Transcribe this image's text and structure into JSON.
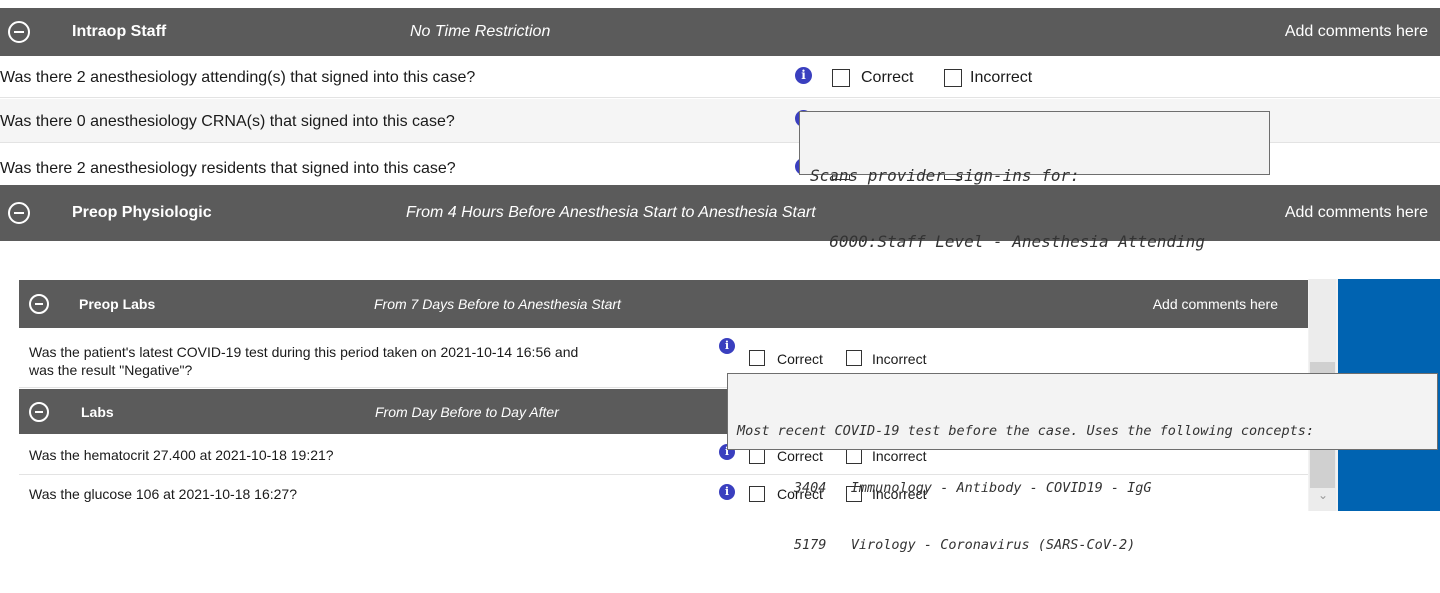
{
  "top_panel": {
    "intraop": {
      "title": "Intraop Staff",
      "range": "No Time Restriction",
      "comments": "Add comments here",
      "questions": [
        {
          "text": "Was there 2 anesthesiology attending(s) that signed into this case?",
          "correct": "Correct",
          "incorrect": "Incorrect"
        },
        {
          "text": "Was there 0 anesthesiology CRNA(s) that signed into this case?"
        },
        {
          "text": "Was there 2 anesthesiology residents that signed into this case?"
        }
      ]
    },
    "tooltip": {
      "line1": "Scans provider sign-ins for:",
      "line2": "  6000:Staff Level - Anesthesia Attending"
    },
    "preop_physiologic": {
      "title": "Preop Physiologic",
      "range": "From 4 Hours Before Anesthesia Start to Anesthesia Start",
      "comments": "Add comments here"
    }
  },
  "bottom_panel": {
    "preop_labs": {
      "title": "Preop Labs",
      "range": "From 7 Days Before to Anesthesia Start",
      "comments": "Add comments here",
      "question_line1": "Was the patient's latest COVID-19 test during this period taken on 2021-10-14 16:56 and",
      "question_line2": "was the result \"Negative\"?",
      "correct": "Correct",
      "incorrect": "Incorrect"
    },
    "tooltip": {
      "line1": "Most recent COVID-19 test before the case. Uses the following concepts:",
      "line2": "       3404   Immunology - Antibody - COVID19 - IgG",
      "line3": "       5179   Virology - Coronavirus (SARS-CoV-2)"
    },
    "labs": {
      "title": "Labs",
      "range": "From Day Before to Day After",
      "questions": [
        {
          "text": "Was the hematocrit 27.400 at 2021-10-18 19:21?",
          "correct": "Correct",
          "incorrect": "Incorrect"
        },
        {
          "text": "Was the glucose 106 at 2021-10-18 16:27?",
          "correct": "Correct",
          "incorrect": "Incorrect"
        }
      ]
    }
  },
  "info_glyph": "i",
  "colors": {
    "header_bg": "#5b5b5b",
    "info_blue": "#3a3fbf",
    "side_blue": "#0063b1",
    "scrollbar": "#d9d9d9"
  }
}
